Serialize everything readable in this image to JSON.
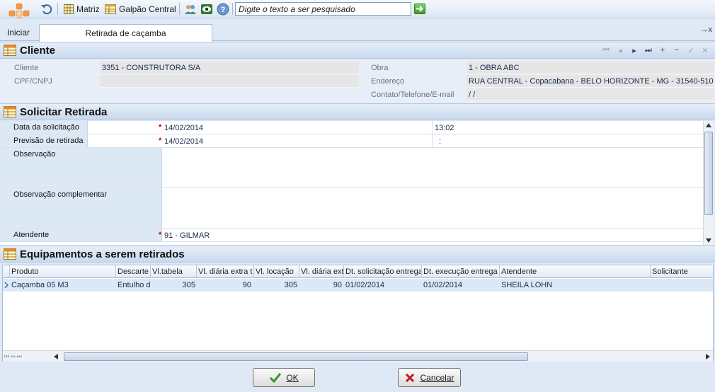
{
  "toolbar": {
    "matriz": "Matriz",
    "galpao": "Galpão Central",
    "search_placeholder": "Digite o texto a ser pesquisado"
  },
  "tabs": {
    "iniciar": "Iniciar",
    "active": "Retirada de caçamba",
    "close_glyph": "→x"
  },
  "cliente": {
    "title": "Cliente",
    "cliente_label": "Cliente",
    "cliente_value": "3351 - CONSTRUTORA S/A",
    "cpf_label": "CPF/CNPJ",
    "cpf_value": "",
    "obra_label": "Obra",
    "obra_value": "1 - OBRA ABC",
    "endereco_label": "Endereço",
    "endereco_value": "RUA CENTRAL - Copacabana - BELO HORIZONTE - MG - 31540-510",
    "contato_label": "Contato/Telefone/E-mail",
    "contato_value": " /  /"
  },
  "solicitar": {
    "title": "Solicitar Retirada",
    "data_label": "Data da solicitação",
    "data_value": "14/02/2014",
    "data_time": "13:02",
    "previsao_label": "Previsão de retirada",
    "previsao_value": "14/02/2014",
    "previsao_time": ":",
    "obs_label": "Observação",
    "obs_comp_label": "Observação complementar",
    "atendente_label": "Atendente",
    "atendente_value": "91 - GILMAR",
    "required_mark": "*"
  },
  "equipamentos": {
    "title": "Equipamentos a serem retirados",
    "columns": [
      "Produto",
      "Descarte",
      "Vl.tabela",
      "Vl. diária extra t",
      "Vl. locação",
      "Vl. diária ext",
      "Dt. solicitação entrega",
      "Dt. execução entrega",
      "Atendente",
      "Solicitante"
    ],
    "rows": [
      [
        "Caçamba 05 M3",
        "Entulho d",
        "305",
        "90",
        "305",
        "90",
        "01/02/2014",
        "01/02/2014",
        "SHEILA LOHN",
        ""
      ]
    ]
  },
  "footer": {
    "ok": "OK",
    "cancel": "Cancelar"
  },
  "colors": {
    "accent": "#c9d9ee",
    "required": "#c00000",
    "ok_check": "#2e9e1f",
    "cancel_x": "#c01818"
  }
}
